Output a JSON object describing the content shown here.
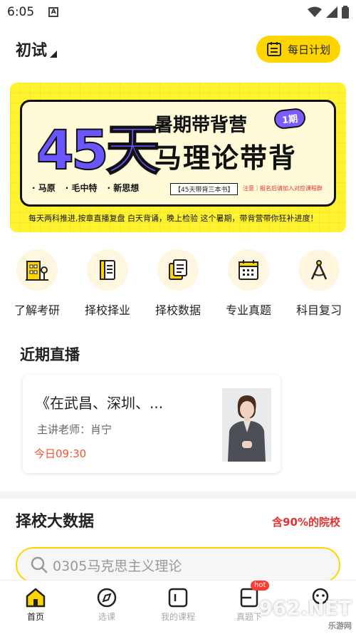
{
  "status_bar": {
    "time": "6:05",
    "badge": "A"
  },
  "header": {
    "exam_label": "初试",
    "plan_button": "每日计划"
  },
  "banner": {
    "days": "45天",
    "camp": "暑期带背营",
    "issue": "1期",
    "subject": "马理论带背",
    "tags": [
      "· 马原",
      "· 毛中特",
      "· 新思想"
    ],
    "books": "【45天带背三本书】",
    "note": "注意｜报名后请加入对应课程群",
    "slogan": "每天两科推进,按章直播复盘  白天背诵，晚上检验 这个暑期，带背营带你狂补进度！"
  },
  "categories": [
    {
      "label": "了解考研",
      "icon": "building-icon"
    },
    {
      "label": "择校择业",
      "icon": "scroll-icon"
    },
    {
      "label": "择校数据",
      "icon": "documents-icon"
    },
    {
      "label": "专业真题",
      "icon": "calendar-icon"
    },
    {
      "label": "科目复习",
      "icon": "compass-icon"
    }
  ],
  "live": {
    "title": "近期直播",
    "card": {
      "title": "《在武昌、深圳、...",
      "teacher": "主讲老师：肖宁",
      "time": "今日09:30"
    }
  },
  "bigdata": {
    "title": "择校大数据",
    "tag": "含90%的院校",
    "search_placeholder": "0305马克思主义理论"
  },
  "tabbar": {
    "items": [
      {
        "label": "首页",
        "icon": "home-icon"
      },
      {
        "label": "选课",
        "icon": "compass-icon"
      },
      {
        "label": "我的课程",
        "icon": "course-icon"
      },
      {
        "label": "真题下",
        "icon": "download-icon"
      },
      {
        "label": "",
        "icon": "profile-icon"
      }
    ],
    "hot_badge": "hot"
  },
  "watermark": {
    "main": "962.NET",
    "sub": "乐游网"
  },
  "colors": {
    "accent": "#ffd500",
    "red": "#ff4d2d",
    "purple": "#6a56ff"
  }
}
